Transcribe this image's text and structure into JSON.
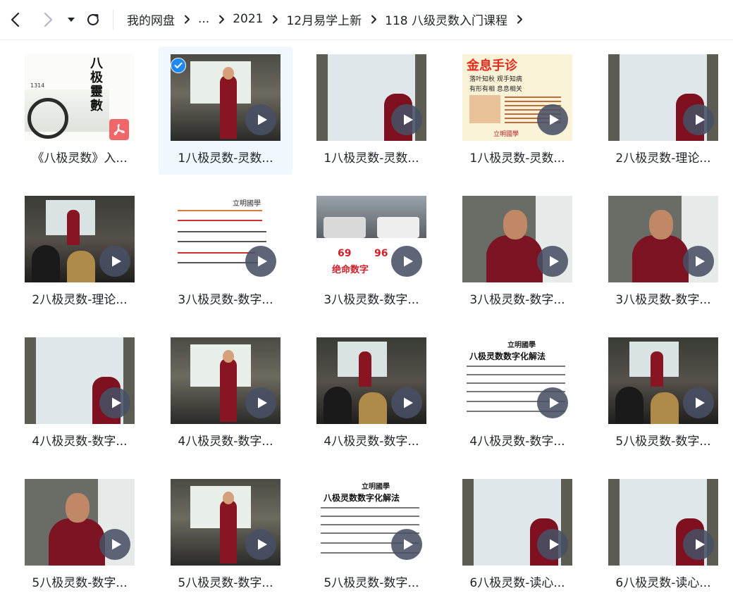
{
  "toolbar": {
    "breadcrumb": [
      "我的网盘",
      "...",
      "2021",
      "12月易学上新",
      "118 八级灵数入门课程"
    ]
  },
  "colors": {
    "accent": "#1e88f5",
    "pdf": "#f0676a",
    "play_overlay": "#485064"
  },
  "files": [
    {
      "name": "《八极灵数》入门课程.pdf",
      "display": "《八极灵数》入...",
      "type": "pdf",
      "selected": false,
      "thumb_text": [
        "八",
        "极",
        "靈",
        "數",
        "1314"
      ]
    },
    {
      "name": "1八极灵数-灵数...",
      "display": "1八极灵数-灵数...",
      "type": "video",
      "selected": true
    },
    {
      "name": "1八极灵数-灵数...",
      "display": "1八极灵数-灵数...",
      "type": "video",
      "selected": false
    },
    {
      "name": "1八极灵数-灵数...",
      "display": "1八极灵数-灵数...",
      "type": "video",
      "selected": false,
      "thumb_text": [
        "金息手诊",
        "落叶知秋 观手知病",
        "有形有相 息息相关",
        "立明國學"
      ]
    },
    {
      "name": "2八极灵数-理论...",
      "display": "2八极灵数-理论...",
      "type": "video",
      "selected": false
    },
    {
      "name": "2八极灵数-理论...",
      "display": "2八极灵数-理论...",
      "type": "video",
      "selected": false
    },
    {
      "name": "3八极灵数-数字...",
      "display": "3八极灵数-数字...",
      "type": "video",
      "selected": false,
      "thumb_text": [
        "立明國學"
      ]
    },
    {
      "name": "3八极灵数-数字...",
      "display": "3八极灵数-数字...",
      "type": "video",
      "selected": false,
      "thumb_text": [
        "69",
        "96",
        "绝命数字"
      ]
    },
    {
      "name": "3八极灵数-数字...",
      "display": "3八极灵数-数字...",
      "type": "video",
      "selected": false
    },
    {
      "name": "3八极灵数-数字...",
      "display": "3八极灵数-数字...",
      "type": "video",
      "selected": false
    },
    {
      "name": "4八极灵数-数字...",
      "display": "4八极灵数-数字...",
      "type": "video",
      "selected": false
    },
    {
      "name": "4八极灵数-数字...",
      "display": "4八极灵数-数字...",
      "type": "video",
      "selected": false
    },
    {
      "name": "4八极灵数-数字...",
      "display": "4八极灵数-数字...",
      "type": "video",
      "selected": false
    },
    {
      "name": "4八极灵数-数字...",
      "display": "4八极灵数-数字...",
      "type": "video",
      "selected": false,
      "thumb_text": [
        "立明國學",
        "八极灵数数字化解法"
      ]
    },
    {
      "name": "5八极灵数-数字...",
      "display": "5八极灵数-数字...",
      "type": "video",
      "selected": false
    },
    {
      "name": "5八极灵数-数字...",
      "display": "5八极灵数-数字...",
      "type": "video",
      "selected": false
    },
    {
      "name": "5八极灵数-数字...",
      "display": "5八极灵数-数字...",
      "type": "video",
      "selected": false
    },
    {
      "name": "5八极灵数-数字...",
      "display": "5八极灵数-数字...",
      "type": "video",
      "selected": false,
      "thumb_text": [
        "立明國學",
        "八极灵数数字化解法"
      ]
    },
    {
      "name": "6八极灵数-读心...",
      "display": "6八极灵数-读心...",
      "type": "video",
      "selected": false
    },
    {
      "name": "6八极灵数-读心...",
      "display": "6八极灵数-读心...",
      "type": "video",
      "selected": false
    }
  ]
}
